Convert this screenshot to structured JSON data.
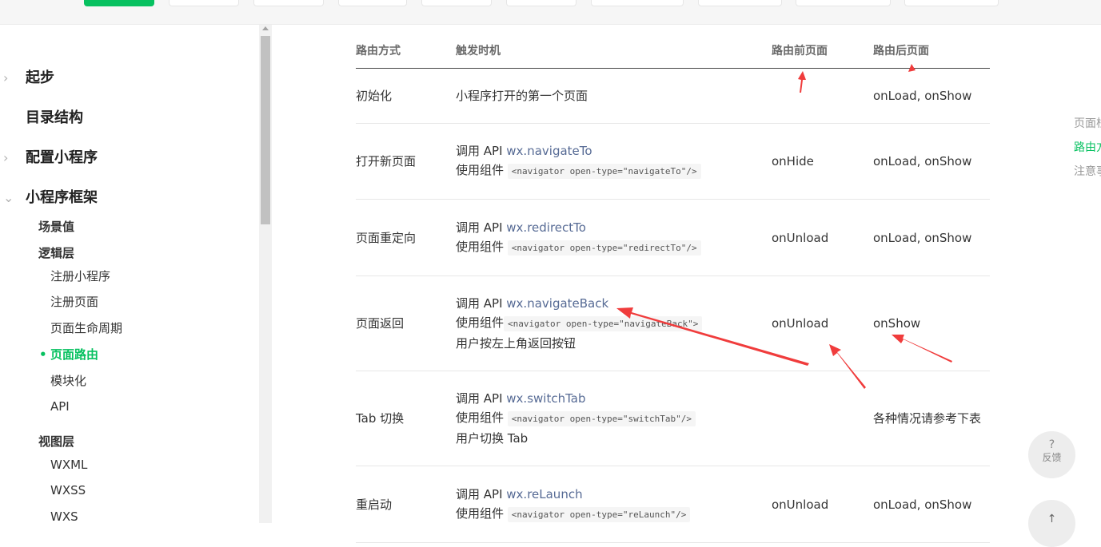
{
  "nav": {
    "items": [
      {
        "label": "起步"
      },
      {
        "label": "目录结构"
      },
      {
        "label": "配置小程序"
      },
      {
        "label": "小程序框架"
      },
      {
        "label": "场景值"
      },
      {
        "label": "逻辑层"
      },
      {
        "label": "注册小程序"
      },
      {
        "label": "注册页面"
      },
      {
        "label": "页面生命周期"
      },
      {
        "label": "页面路由"
      },
      {
        "label": "模块化"
      },
      {
        "label": "API"
      },
      {
        "label": "视图层"
      },
      {
        "label": "WXML"
      },
      {
        "label": "WXSS"
      },
      {
        "label": "WXS"
      }
    ],
    "active_marker": "•"
  },
  "table": {
    "headers": [
      "路由方式",
      "触发时机",
      "路由前页面",
      "路由后页面"
    ],
    "rows": [
      {
        "method": "初始化",
        "lines": [
          {
            "text": "小程序打开的第一个页面"
          }
        ],
        "before": "",
        "after": "onLoad, onShow"
      },
      {
        "method": "打开新页面",
        "lines": [
          {
            "prefix": "调用 API ",
            "api": "wx.navigateTo"
          },
          {
            "prefix": "使用组件 ",
            "code": "<navigator open-type=\"navigateTo\"/>"
          }
        ],
        "before": "onHide",
        "after": "onLoad, onShow"
      },
      {
        "method": "页面重定向",
        "lines": [
          {
            "prefix": "调用 API ",
            "api": "wx.redirectTo"
          },
          {
            "prefix": "使用组件 ",
            "code": "<navigator open-type=\"redirectTo\"/>"
          }
        ],
        "before": "onUnload",
        "after": "onLoad, onShow"
      },
      {
        "method": "页面返回",
        "lines": [
          {
            "prefix": "调用 API ",
            "api": "wx.navigateBack"
          },
          {
            "prefix": "使用组件",
            "code": "<navigator open-type=\"navigateBack\">"
          },
          {
            "text": "用户按左上角返回按钮"
          }
        ],
        "before": "onUnload",
        "after": "onShow"
      },
      {
        "method": "Tab 切换",
        "lines": [
          {
            "prefix": "调用 API ",
            "api": "wx.switchTab"
          },
          {
            "prefix": "使用组件 ",
            "code": "<navigator open-type=\"switchTab\"/>"
          },
          {
            "text": "用户切换 Tab"
          }
        ],
        "before": "",
        "after": "各种情况请参考下表"
      },
      {
        "method": "重启动",
        "lines": [
          {
            "prefix": "调用 API ",
            "api": "wx.reLaunch"
          },
          {
            "prefix": "使用组件 ",
            "code": "<navigator open-type=\"reLaunch\"/>"
          }
        ],
        "before": "onUnload",
        "after": "onLoad, onShow"
      }
    ]
  },
  "toc": {
    "items": [
      "页面栈",
      "路由方式",
      "注意事项"
    ]
  },
  "float": {
    "feedback_icon": "?",
    "feedback_label": "反馈",
    "back_top_icon": "↑"
  },
  "colors": {
    "accent": "#07c160",
    "link": "#576b95",
    "annotation": "#f03c3c"
  }
}
